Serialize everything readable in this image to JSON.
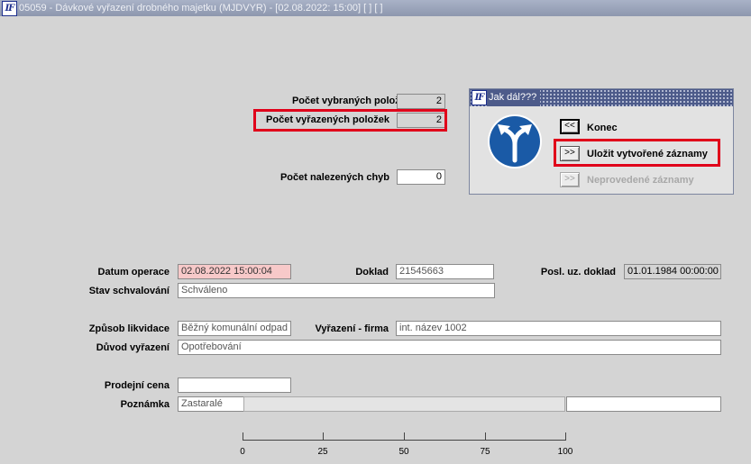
{
  "window": {
    "title": "05059 - Dávkové vyřazení drobného majetku (MJDVYR) - [02.08.2022: 15:00]  [ ]  [ ]",
    "logo": "IF"
  },
  "counts": {
    "selected_label": "Počet vybraných položek",
    "selected_value": "2",
    "discarded_label": "Počet vyřazených položek",
    "discarded_value": "2",
    "errors_label": "Počet nalezených chyb",
    "errors_value": "0"
  },
  "dialog": {
    "title": "Jak dál???",
    "logo": "IF",
    "icon": "road-fork-sign-icon",
    "buttons": [
      {
        "symbol": "<<",
        "label": "Konec",
        "enabled": true
      },
      {
        "symbol": ">>",
        "label": "Uložit vytvořené záznamy",
        "enabled": true
      },
      {
        "symbol": ">>",
        "label": "Neprovedené záznamy",
        "enabled": false
      }
    ]
  },
  "form": {
    "datum_label": "Datum operace",
    "datum_value": "02.08.2022 15:00:04",
    "doklad_label": "Doklad",
    "doklad_value": "21545663",
    "posl_label": "Posl. uz. doklad",
    "posl_value": "01.01.1984 00:00:00",
    "stav_label": "Stav schvalování",
    "stav_value": "Schváleno",
    "zpusob_label": "Způsob likvidace",
    "zpusob_value": "Běžný komunální odpad",
    "firma_label": "Vyřazení - firma",
    "firma_value": "int. název 1002",
    "duvod_label": "Důvod vyřazení",
    "duvod_value": "Opotřebování",
    "cena_label": "Prodejní cena",
    "cena_value": "",
    "poznamka_label": "Poznámka",
    "poznamka_value": "Zastaralé",
    "poznamka_extra": ""
  },
  "progress": {
    "value_percent": 0,
    "scale_labels": [
      "0",
      "25",
      "50",
      "75",
      "100"
    ]
  },
  "colors": {
    "highlight": "#e0001a",
    "required_field": "#f7c9c9",
    "title_bar": "#8d97ae",
    "dialog_title": "#4d5b8a"
  }
}
